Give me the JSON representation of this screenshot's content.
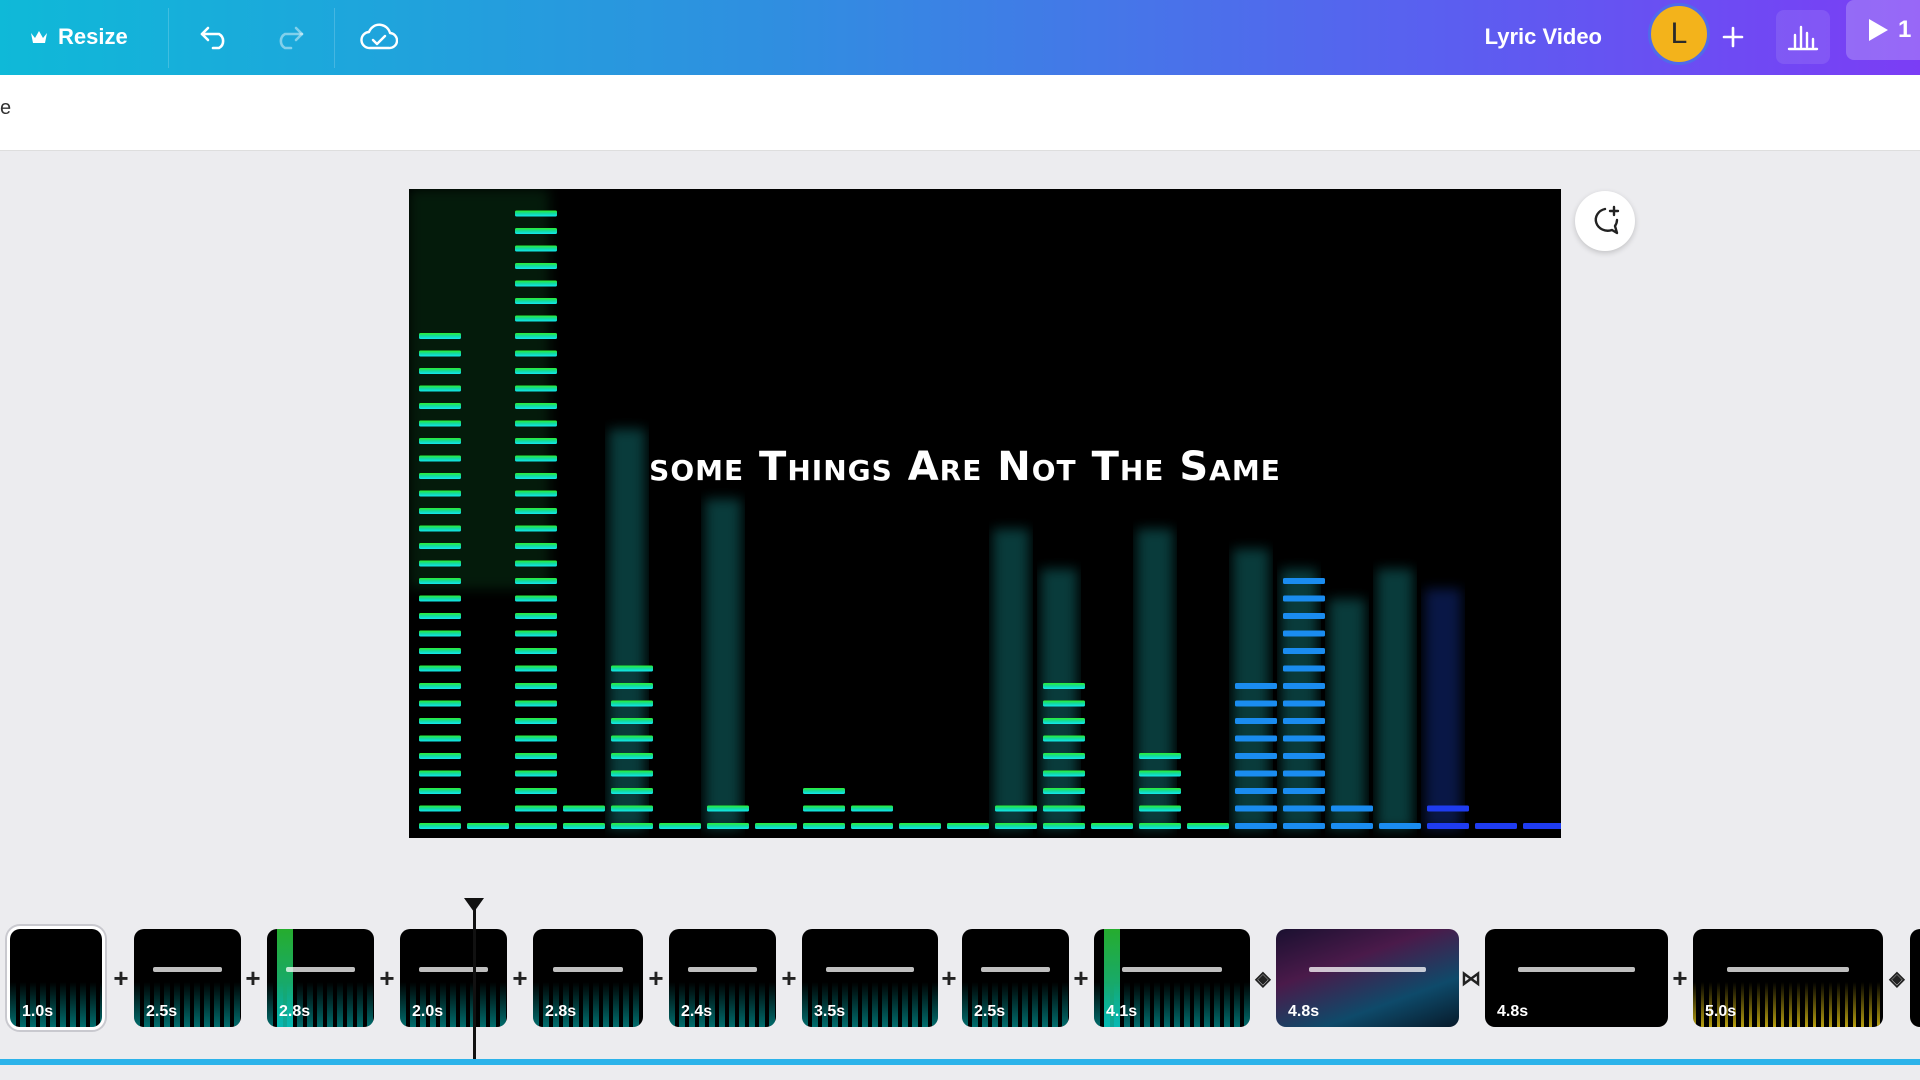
{
  "topbar": {
    "resize_label": "Resize",
    "title": "Lyric Video",
    "avatar_letter": "L",
    "play_label": "1",
    "icons": [
      "crown-icon",
      "undo-icon",
      "redo-icon",
      "cloud-saved-icon",
      "plus-icon",
      "bar-chart-icon",
      "play-icon"
    ]
  },
  "subbar": {
    "partial_text": "e"
  },
  "canvas": {
    "lyric": "some Things Are Not The Same"
  },
  "comment_icon": "add-comment-icon",
  "timeline": {
    "clips": [
      {
        "duration": "1.0s",
        "selected": true
      },
      {
        "duration": "2.5s"
      },
      {
        "duration": "2.8s"
      },
      {
        "duration": "2.0s"
      },
      {
        "duration": "2.8s"
      },
      {
        "duration": "2.4s"
      },
      {
        "duration": "3.5s"
      },
      {
        "duration": "2.5s"
      },
      {
        "duration": "4.1s"
      },
      {
        "duration": "4.8s"
      },
      {
        "duration": "4.8s"
      },
      {
        "duration": "5.0s"
      }
    ],
    "transitions": [
      "+",
      "+",
      "+",
      "+",
      "+",
      "+",
      "+",
      "+",
      "◈",
      "⋈",
      "+",
      "◈"
    ]
  },
  "colors": {
    "accent": "#2cb3ea",
    "avatar": "#f3b31b",
    "gradient_start": "#0fb9d8",
    "gradient_end": "#7b3df5"
  }
}
